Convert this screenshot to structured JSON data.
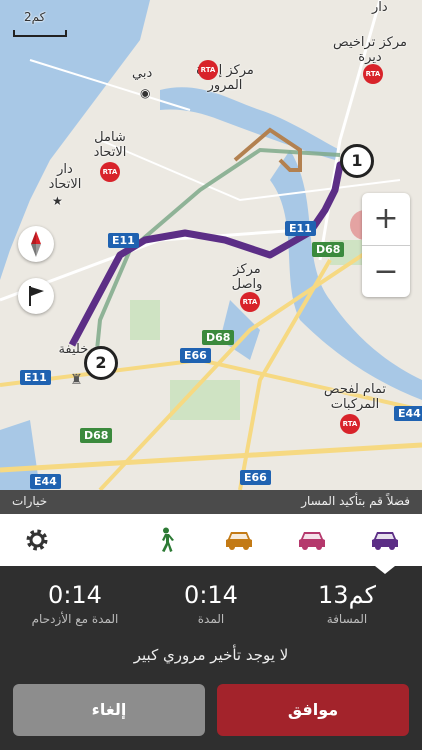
{
  "map": {
    "scale_label": "2كم",
    "places": {
      "dubai": "دبي",
      "traffic_admin": "مركز إدارة المرور",
      "deira_licensing": "مركز تراخيص ديرة",
      "union_mall": "شامل الاتحاد",
      "union_house": "دار الاتحاد",
      "wasl_center": "مركز واصل",
      "vehicle_testing": "تمام لفحص المركبات",
      "burj_khalifa": "برج خليفة",
      "top_label": "دار"
    },
    "roads": {
      "e11_a": "E11",
      "e11_b": "E11",
      "e11_c": "E11",
      "d68_a": "D68",
      "d68_b": "D68",
      "d68_c": "D68",
      "e66_a": "E66",
      "e66_b": "E66",
      "e44_a": "E44",
      "e44_b": "E44"
    },
    "rta_badge": "RTA",
    "markers": {
      "start": "1",
      "end": "2"
    },
    "zoom_in": "+",
    "zoom_out": "−"
  },
  "options_bar": {
    "options_label": "خيارات",
    "confirm_route": "فضلاً قم بتأكيد المسار"
  },
  "modes": [
    {
      "icon": "settings-gear-icon",
      "color": "#333333"
    },
    {
      "icon": "walking-person-icon",
      "color": "#2c7a34"
    },
    {
      "icon": "car-icon",
      "color": "#c37a15"
    },
    {
      "icon": "car-icon",
      "color": "#b5386c"
    },
    {
      "icon": "car-icon",
      "color": "#5c2e86"
    }
  ],
  "selected_mode": 4,
  "route_colors": {
    "main": "#5c2e86",
    "alt1": "#7fa98a",
    "alt2": "#b38150"
  },
  "summary": {
    "distance_value": "13كم",
    "distance_label": "المسافة",
    "duration_value": "0:14",
    "duration_label": "المدة",
    "traffic_value": "0:14",
    "traffic_label": "المدة مع الأزدحام",
    "notice": "لا يوجد تأخير مروري كبير"
  },
  "buttons": {
    "confirm": "موافق",
    "cancel": "إلغاء"
  }
}
